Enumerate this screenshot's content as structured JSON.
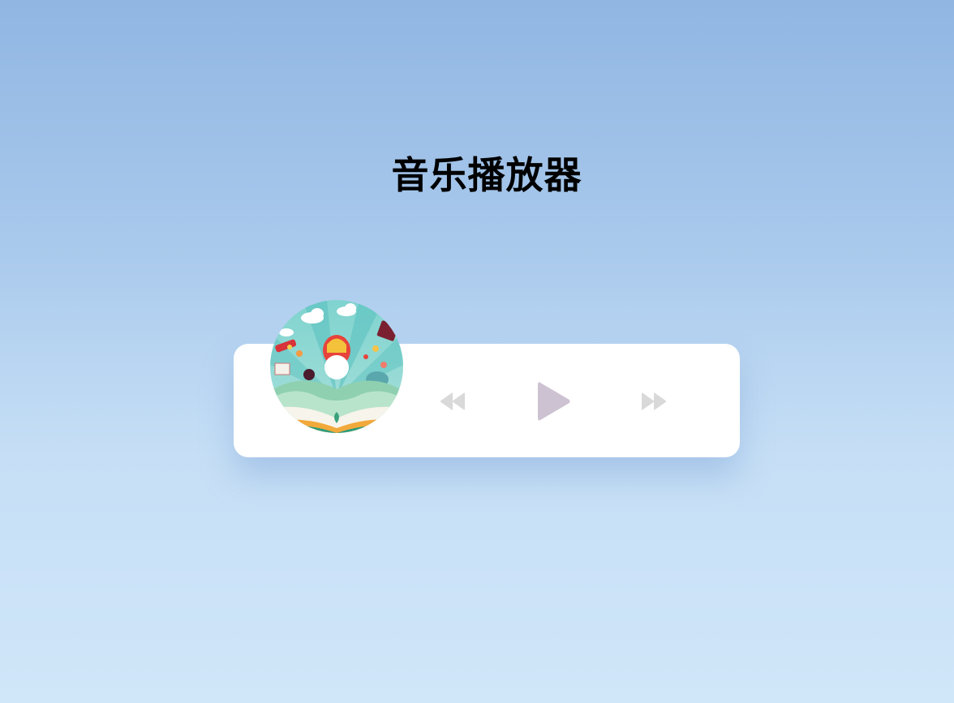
{
  "page": {
    "title": "音乐播放器"
  },
  "player": {
    "cover_icon": "album-cover-disc-icon",
    "controls": {
      "prev_icon": "rewind-icon",
      "play_icon": "play-icon",
      "next_icon": "fast-forward-icon"
    },
    "colors": {
      "card_background": "#ffffff",
      "play_button": "#cdc2d1",
      "skip_buttons": "#d9d9d9"
    }
  }
}
